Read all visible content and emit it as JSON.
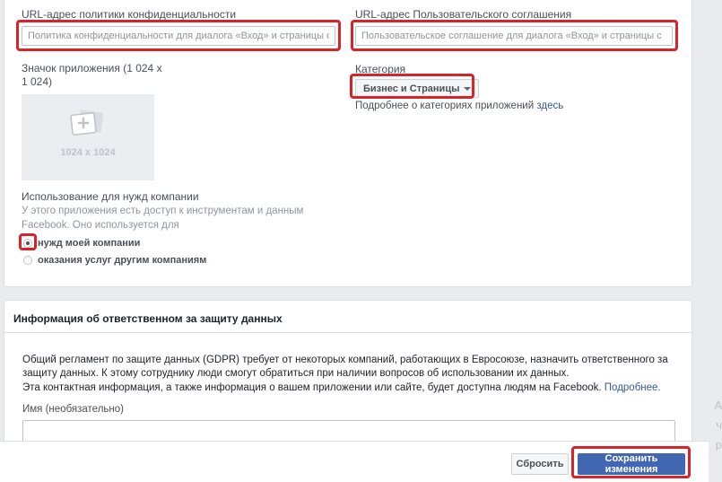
{
  "privacy_policy": {
    "label": "URL-адрес политики конфиденциальности",
    "placeholder": "Политика конфиденциальности для диалога «Вход» и страницы с"
  },
  "terms_of_service": {
    "label": "URL-адрес Пользовательского соглашения",
    "placeholder": "Пользовательское соглашение для диалога «Вход» и страницы с"
  },
  "app_icon": {
    "label_line1": "Значок приложения (1 024 x",
    "label_line2": "1 024)",
    "size_text": "1024 x 1024",
    "icon": "photo-add-icon"
  },
  "category": {
    "label": "Категория",
    "selected": "Бизнес и Страницы",
    "hint_prefix": "Подробнее о категориях приложений ",
    "hint_link": "здесь"
  },
  "business_use": {
    "label": "Использование для нужд компании",
    "hint_line1": "У этого приложения есть доступ к инструментам и данным",
    "hint_line2": "Facebook. Оно используется для",
    "options": [
      {
        "label": "нужд моей компании",
        "checked": true
      },
      {
        "label": "оказания услуг другим компаниям",
        "checked": false
      }
    ]
  },
  "gdpr": {
    "title": "Информация об ответственном за защиту данных",
    "para_line1": "Общий регламент по защите данных (GDPR) требует от некоторых компаний, работающих в Евросоюзе, назначить ответственного за",
    "para_line2": "защиту данных. К этому сотруднику люди смогут обратиться при наличии вопросов об использовании их данных.",
    "para_line3": "Эта контактная информация, а также информация о вашем приложении или сайте, будет доступна людям на Facebook. ",
    "more_link": "Подробнее.",
    "name_label": "Имя (необязательно)"
  },
  "footer": {
    "reset_label": "Сбросить",
    "save_label": "Сохранить изменения"
  },
  "right_edge": [
    "A",
    "ч",
    "р"
  ],
  "colors": {
    "accent": "#4267b2",
    "link": "#365899",
    "highlight": "#d8232a"
  }
}
